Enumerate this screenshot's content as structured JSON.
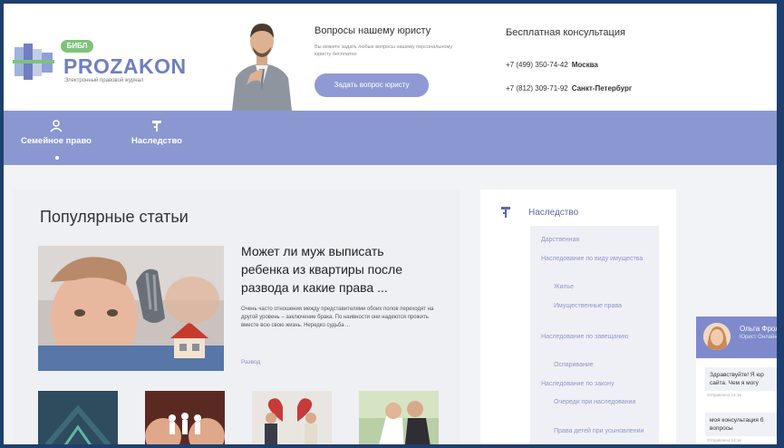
{
  "logo": {
    "badge": "БИБЛ",
    "title": "PROZAKON",
    "subtitle": "Электронный правовой журнал"
  },
  "ask": {
    "title": "Вопросы нашему юристу",
    "description": "Вы можете задать любые вопросы нашему персональному юристу бесплатно",
    "button": "Задать вопрос юристу"
  },
  "consult": {
    "title": "Бесплатная консультация",
    "phone1": "+7 (499) 350-74-42",
    "city1": "Москва",
    "phone2": "+7 (812) 309-71-92",
    "city2": "Санкт-Петербург"
  },
  "nav": {
    "items": [
      {
        "label": "Семейное право",
        "icon": "family-icon"
      },
      {
        "label": "Наследство",
        "icon": "inheritance-icon"
      }
    ]
  },
  "popular": {
    "title": "Популярные статьи",
    "featured": {
      "title": "Может ли муж выписать ребенка из квартиры после развода и какие права ...",
      "excerpt": "Очень часто отношения между представителями обоих полов переходят на другой уровень – заключение брака. По наивности они надеются прожить вместе всю свою жизнь. Нередко судьба ...",
      "category": "Развод"
    }
  },
  "sidebar": {
    "heading": "Наследство",
    "links": [
      "Дарственная",
      "Наследование по виду имущества",
      "Жилье",
      "Имущественные права",
      "Наследование по завещанию",
      "Оспаривание",
      "Наследование по закону",
      "Очереди при наследовании",
      "Права детей при усыновлении"
    ]
  },
  "chat": {
    "name": "Ольга Фрол",
    "role": "Юрист Онлайн",
    "messages": [
      {
        "text": "Здравствуйте! Я юр сайта. Чем я могу",
        "time": "Отправлено 14:16"
      },
      {
        "text": "моя консультация б вопросы",
        "time": "Отправлено 14:16"
      }
    ]
  },
  "colors": {
    "nav": "#8b97d1",
    "accent": "#6f7fc2",
    "button": "#8f9ad4",
    "frame": "#1e3f6e"
  }
}
